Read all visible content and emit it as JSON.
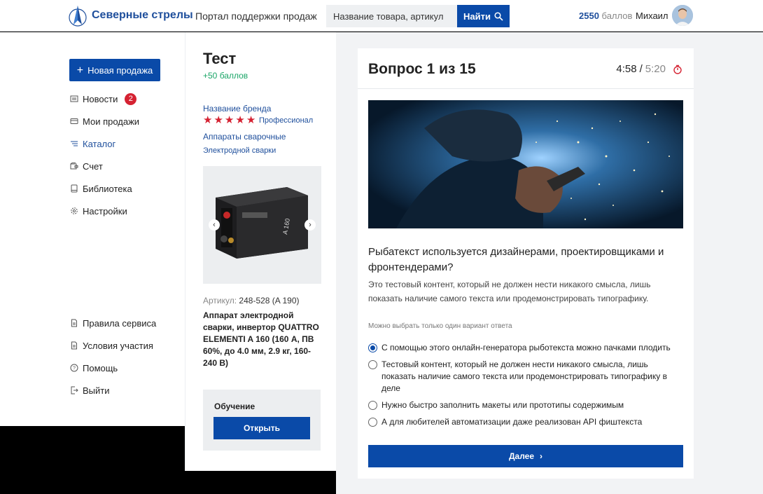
{
  "header": {
    "brand": "Северные стрелы",
    "portal_title": "Портал поддержки продаж",
    "search_placeholder": "Название товара, артикул",
    "search_button": "Найти",
    "points_value": "2550",
    "points_label": "баллов",
    "user_name": "Михаил"
  },
  "sidebar": {
    "new_sale": "Новая продажа",
    "items": [
      {
        "label": "Новости",
        "badge": "2",
        "icon": "news-icon"
      },
      {
        "label": "Мои продажи",
        "icon": "card-icon"
      },
      {
        "label": "Каталог",
        "icon": "list-icon",
        "active": true
      },
      {
        "label": "Счет",
        "icon": "wallet-icon"
      },
      {
        "label": "Библиотека",
        "icon": "book-icon"
      },
      {
        "label": "Настройки",
        "icon": "gear-icon"
      }
    ],
    "footer_items": [
      {
        "label": "Правила сервиса",
        "icon": "document-icon"
      },
      {
        "label": "Условия участия",
        "icon": "document-icon"
      },
      {
        "label": "Помощь",
        "icon": "help-icon"
      },
      {
        "label": "Выйти",
        "icon": "logout-icon"
      }
    ]
  },
  "product": {
    "title": "Тест",
    "points": "+50 баллов",
    "brand": "Название бренда",
    "rating": 5,
    "level": "Профессионал",
    "category": "Аппараты сварочные",
    "subcategory": "Электродной сварки",
    "sku_label": "Артикул:",
    "sku_value": "248-528 (A 190)",
    "name": "Аппарат электродной сварки, инвертор QUATTRO ELEMENTI A 160 (160 А, ПВ 60%, до 4.0 мм, 2.9 кг, 160-240 В)",
    "learning_title": "Обучение",
    "learning_button": "Открыть"
  },
  "quiz": {
    "title": "Вопрос 1 из 15",
    "timer_elapsed": "4:58",
    "timer_separator": "/",
    "timer_total": "5:20",
    "question": "Рыбатекст используется дизайнерами, проектировщиками и фронтендерами?",
    "description": "Это тестовый контент, который не должен нести никакого смысла, лишь показать наличие самого текста или продемонстрировать типографику.",
    "hint": "Можно выбрать только один вариант ответа",
    "options": [
      {
        "label": "С помощью этого онлайн-генератора рыботекста можно пачками плодить",
        "selected": true
      },
      {
        "label": "Тестовый контент, который не должен нести никакого смысла, лишь показать наличие самого текста или продемонстрировать типографику в деле",
        "selected": false
      },
      {
        "label": "Нужно быстро заполнить макеты или прототипы содержимым",
        "selected": false
      },
      {
        "label": "А для любителей автоматизации даже реализован API фиштекста",
        "selected": false
      }
    ],
    "next_button": "Далее"
  },
  "colors": {
    "primary": "#0a4aa8",
    "brand_text": "#1f4f9c",
    "accent_red": "#d52232",
    "points_green": "#1aa567"
  }
}
